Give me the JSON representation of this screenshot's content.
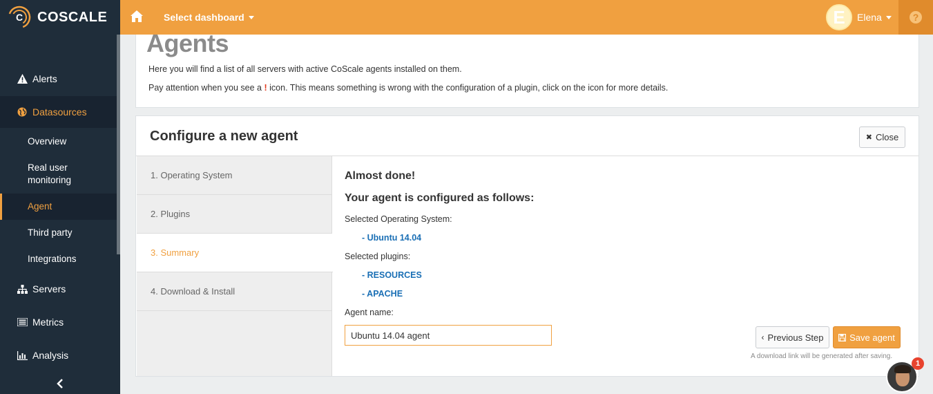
{
  "app": {
    "logo_text": "COSCALE"
  },
  "sidebar": {
    "items": [
      {
        "label": "Alerts",
        "icon": "warning-icon"
      },
      {
        "label": "Datasources",
        "icon": "globe-icon",
        "active": true
      },
      {
        "label": "Servers",
        "icon": "sitemap-icon"
      },
      {
        "label": "Metrics",
        "icon": "list-icon"
      },
      {
        "label": "Analysis",
        "icon": "bar-chart-icon"
      }
    ],
    "subitems": [
      {
        "label": "Overview"
      },
      {
        "label": "Real user monitoring"
      },
      {
        "label": "Agent",
        "active": true
      },
      {
        "label": "Third party"
      },
      {
        "label": "Integrations"
      }
    ]
  },
  "topbar": {
    "dashboard_select": "Select dashboard",
    "user_initial": "E",
    "user_name": "Elena"
  },
  "page": {
    "title": "Agents",
    "intro_line1": "Here you will find a list of all servers with active CoScale agents installed on them.",
    "intro_line2_pre": "Pay attention when you see a",
    "intro_line2_mark": "!",
    "intro_line2_post": "icon. This means something is wrong with the configuration of a plugin, click on the icon for more details."
  },
  "configure": {
    "title": "Configure a new agent",
    "close_label": "Close",
    "steps": [
      {
        "label": "1. Operating System"
      },
      {
        "label": "2. Plugins"
      },
      {
        "label": "3. Summary",
        "active": true
      },
      {
        "label": "4. Download & Install"
      }
    ],
    "summary": {
      "heading_done": "Almost done!",
      "heading_config": "Your agent is configured as follows:",
      "os_label": "Selected Operating System:",
      "os_value": "- Ubuntu 14.04",
      "plugins_label": "Selected plugins:",
      "plugins": [
        "- RESOURCES",
        "- APACHE"
      ],
      "name_label": "Agent name:",
      "name_value": "Ubuntu 14.04 agent"
    },
    "prev_label": "Previous Step",
    "save_label": "Save agent",
    "note": "A download link will be generated after saving."
  },
  "chat": {
    "badge_count": "1"
  },
  "colors": {
    "accent": "#f0a040",
    "sidebar_bg": "#1f2d3a",
    "link_blue": "#1a6fb5"
  }
}
